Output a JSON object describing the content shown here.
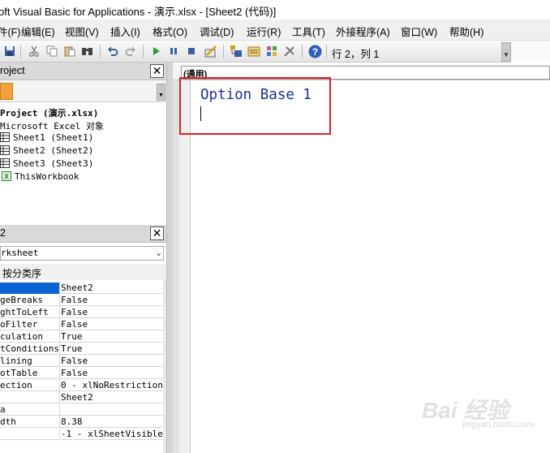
{
  "window": {
    "title": "oft Visual Basic for Applications - 演示.xlsx - [Sheet2 (代码)]"
  },
  "menu": [
    {
      "label": "件(F)",
      "icon": "none"
    },
    {
      "label": "编辑(E)"
    },
    {
      "label": "视图(V)"
    },
    {
      "label": "插入(I)"
    },
    {
      "label": "格式(O)"
    },
    {
      "label": "调试(D)"
    },
    {
      "label": "运行(R)"
    },
    {
      "label": "工具(T)"
    },
    {
      "label": "外接程序(A)"
    },
    {
      "label": "窗口(W)"
    },
    {
      "label": "帮助(H)"
    }
  ],
  "toolbar": {
    "position_text": "行 2，列 1",
    "buttons": [
      "save-icon",
      "cut-icon",
      "copy-icon",
      "paste-icon",
      "find-icon",
      "undo-icon",
      "redo-icon",
      "run-icon",
      "break-icon",
      "reset-icon",
      "design-mode-icon",
      "project-explorer-icon",
      "properties-icon",
      "object-browser-icon",
      "toolbox-icon",
      "help-icon"
    ]
  },
  "project_pane": {
    "title": "roject",
    "tree": [
      {
        "label": "Project (演示.xlsx)",
        "bold": true
      },
      {
        "label": "Microsoft Excel 对象"
      },
      {
        "label": "Sheet1 (Sheet1)",
        "icon": "sheet-icon"
      },
      {
        "label": "Sheet2 (Sheet2)",
        "icon": "sheet-icon"
      },
      {
        "label": "Sheet3 (Sheet3)",
        "icon": "sheet-icon"
      },
      {
        "label": "ThisWorkbook",
        "icon": "workbook-icon"
      }
    ]
  },
  "properties_pane": {
    "title": "2",
    "object_select": "rksheet",
    "tab_label": "按分类序",
    "rows": [
      {
        "name": "",
        "value": "Sheet2",
        "selected": true
      },
      {
        "name": "geBreaks",
        "value": "False"
      },
      {
        "name": "ghtToLeft",
        "value": "False"
      },
      {
        "name": "oFilter",
        "value": "False"
      },
      {
        "name": "culation",
        "value": "True"
      },
      {
        "name": "matConditions",
        "value": "True"
      },
      {
        "name": "lining",
        "value": "False"
      },
      {
        "name": "otTable",
        "value": "False"
      },
      {
        "name": "ection",
        "value": "0 - xlNoRestrictions"
      },
      {
        "name": "",
        "value": "Sheet2"
      },
      {
        "name": "a",
        "value": ""
      },
      {
        "name": "dth",
        "value": "8.38"
      },
      {
        "name": "",
        "value": "-1 - xlSheetVisible"
      }
    ]
  },
  "code_window": {
    "object_combo": "(通用)",
    "lines": [
      "Option Base 1"
    ]
  },
  "colors": {
    "code_text": "#1a2e9e",
    "selection": "#0a64d2",
    "annotation_box": "#e02020"
  },
  "watermark": {
    "text": "Bai 经验",
    "sub": "jingyan.baidu.com"
  }
}
